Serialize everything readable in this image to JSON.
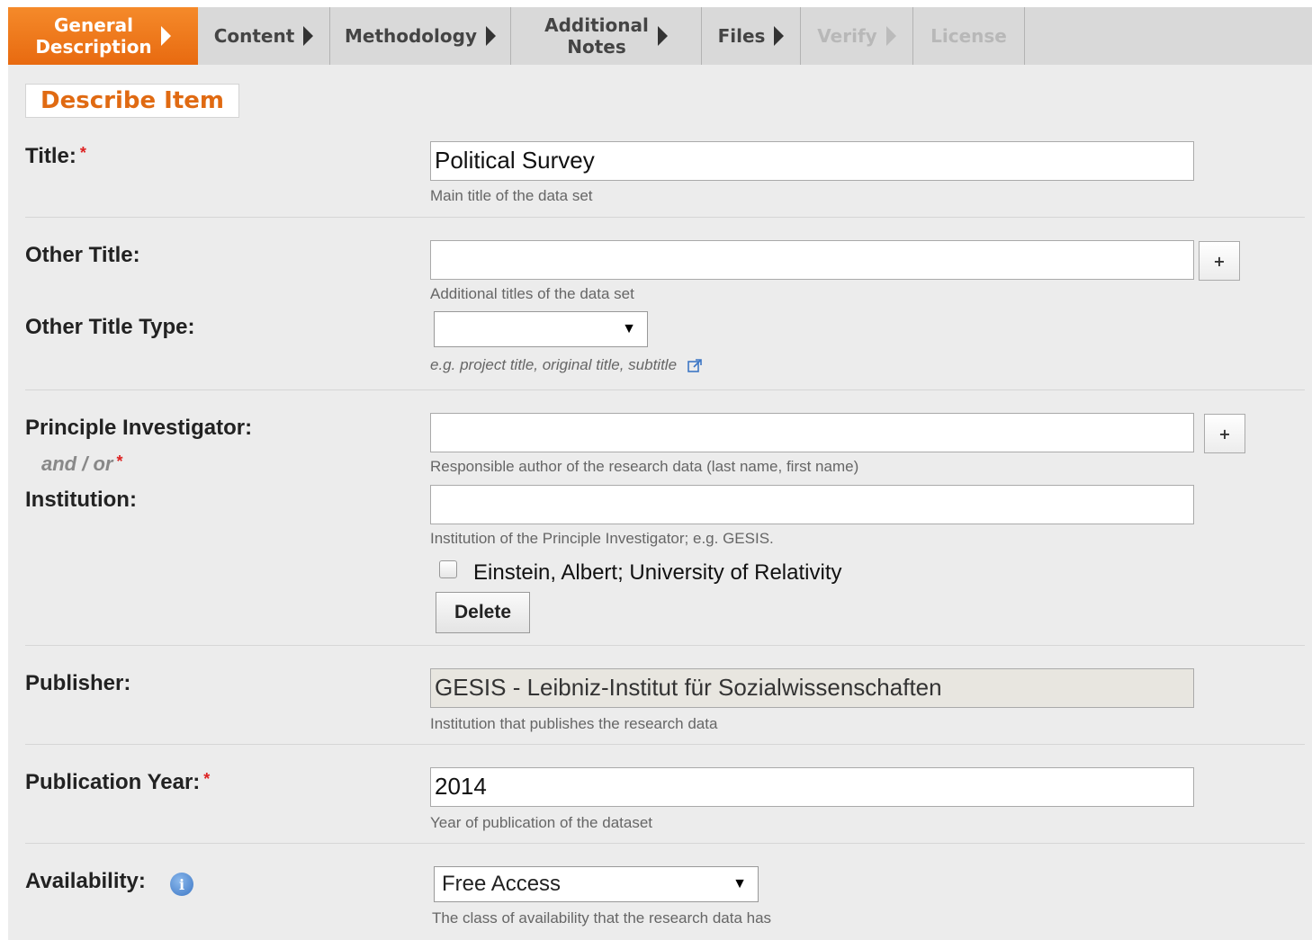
{
  "tabs": [
    {
      "label_line1": "General",
      "label_line2": "Description",
      "state": "active"
    },
    {
      "label": "Content",
      "state": "normal"
    },
    {
      "label": "Methodology",
      "state": "normal"
    },
    {
      "label_line1": "Additional",
      "label_line2": "Notes",
      "state": "normal"
    },
    {
      "label": "Files",
      "state": "normal"
    },
    {
      "label": "Verify",
      "state": "disabled"
    },
    {
      "label": "License",
      "state": "disabled"
    }
  ],
  "heading": "Describe Item",
  "required_marker": "*",
  "fields": {
    "title": {
      "label": "Title:",
      "value": "Political Survey",
      "hint": "Main title of the data set"
    },
    "other_title": {
      "label": "Other Title:",
      "value": "",
      "hint": "Additional titles of the data set",
      "add_label": "+"
    },
    "other_title_type": {
      "label": "Other Title Type:",
      "selected": "",
      "hint": "e.g. project title, original title, subtitle"
    },
    "investigator": {
      "label": "Principle Investigator:",
      "and_or": "and / or",
      "value": "",
      "hint": "Responsible author of the research data (last name, first name)",
      "add_label": "+"
    },
    "institution": {
      "label": "Institution:",
      "value": "",
      "hint": "Institution of the Principle Investigator; e.g. GESIS."
    },
    "entry": {
      "text": "Einstein, Albert; University of Relativity",
      "checked": false
    },
    "delete_label": "Delete",
    "publisher": {
      "label": "Publisher:",
      "value": "GESIS - Leibniz-Institut für Sozialwissenschaften",
      "hint": "Institution that publishes the research data"
    },
    "publication_year": {
      "label": "Publication Year:",
      "value": "2014",
      "hint": "Year of publication of the dataset"
    },
    "availability": {
      "label": "Availability:",
      "selected": "Free Access",
      "hint": "The class of availability that the research data has"
    }
  },
  "icons": {
    "info": "info-icon",
    "external_link": "external-link-icon",
    "caret": "chevron-down-icon",
    "arrow": "triangle-right-icon"
  },
  "colors": {
    "accent": "#e86a10",
    "required": "#dd2222",
    "info": "#3d77c5"
  }
}
